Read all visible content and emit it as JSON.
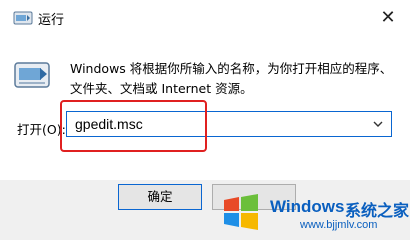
{
  "window": {
    "title": "运行",
    "close_glyph": "✕"
  },
  "description": "Windows 将根据你所输入的名称，为你打开相应的程序、文件夹、文档或 Internet 资源。",
  "open": {
    "label": "打开(O):",
    "value": "gpedit.msc"
  },
  "buttons": {
    "ok_label": "确定"
  },
  "watermark": {
    "brand": "Windows",
    "suffix": "系统之家",
    "url": "www.bjjmlv.com"
  },
  "colors": {
    "accent": "#0a66d1",
    "annotation": "#e02020",
    "footer_bg": "#f0f0f0",
    "watermark": "#0a5fbf"
  }
}
